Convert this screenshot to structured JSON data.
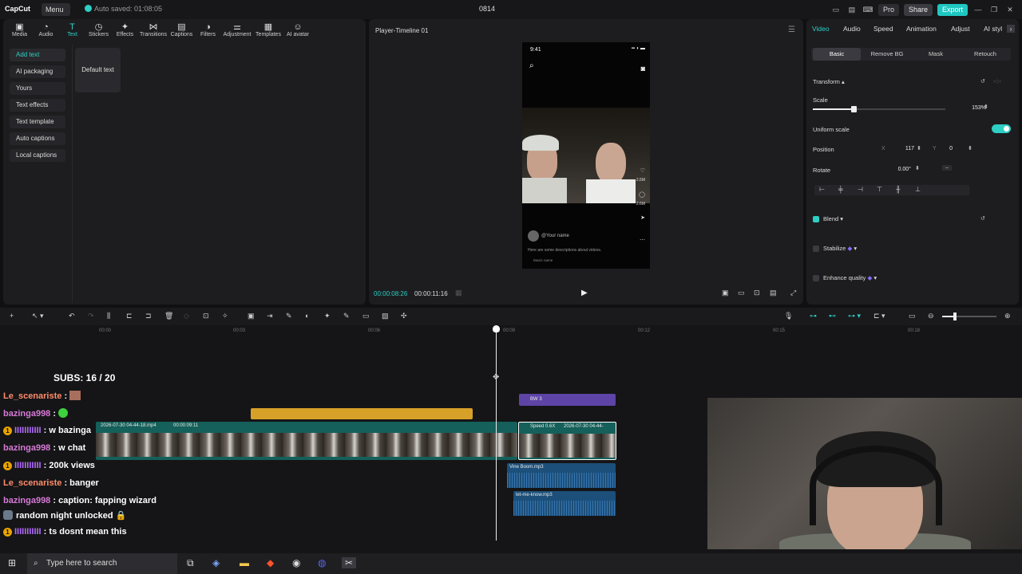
{
  "titlebar": {
    "app_name": "CapCut",
    "menu_label": "Menu",
    "autosave": "Auto saved: 01:08:05",
    "project_title": "0814",
    "pro_label": "Pro",
    "share_label": "Share",
    "export_label": "Export"
  },
  "media_tabs": [
    {
      "label": "Media",
      "icon": "media-icon"
    },
    {
      "label": "Audio",
      "icon": "audio-icon"
    },
    {
      "label": "Text",
      "icon": "text-icon",
      "active": true
    },
    {
      "label": "Stickers",
      "icon": "stickers-icon"
    },
    {
      "label": "Effects",
      "icon": "effects-icon"
    },
    {
      "label": "Transitions",
      "icon": "transitions-icon"
    },
    {
      "label": "Captions",
      "icon": "captions-icon"
    },
    {
      "label": "Filters",
      "icon": "filters-icon"
    },
    {
      "label": "Adjustment",
      "icon": "adjustment-icon"
    },
    {
      "label": "Templates",
      "icon": "templates-icon"
    },
    {
      "label": "AI avatar",
      "icon": "ai-avatar-icon"
    }
  ],
  "text_sidebar": [
    "Add text",
    "AI packaging",
    "Yours",
    "Text effects",
    "Text template",
    "Auto captions",
    "Local captions"
  ],
  "default_text_card": "Default text",
  "player": {
    "title": "Player-Timeline 01",
    "current_time": "00:00:08:26",
    "total_time": "00:00:11:16",
    "phone_time": "9:41",
    "phone_name": "@Your name",
    "phone_desc": "Here are some descriptions about videos.",
    "phone_music": "Music name",
    "likes": "2.6M",
    "comments": "2.6M"
  },
  "inspector": {
    "tabs": [
      "Video",
      "Audio",
      "Speed",
      "Animation",
      "Adjust",
      "AI styl"
    ],
    "subtabs": [
      "Basic",
      "Remove BG",
      "Mask",
      "Retouch"
    ],
    "transform_label": "Transform",
    "scale_label": "Scale",
    "scale_value": "153%",
    "scale_fraction": 0.31,
    "uniform_scale_label": "Uniform scale",
    "position_label": "Position",
    "pos_x_label": "X",
    "pos_x": "117",
    "pos_y_label": "Y",
    "pos_y": "0",
    "rotate_label": "Rotate",
    "rotate_value": "0.00°",
    "blend_label": "Blend",
    "stabilize_label": "Stabilize",
    "enhance_label": "Enhance quality"
  },
  "timeline": {
    "ruler": [
      "00:00",
      "00:03",
      "00:06",
      "00:09",
      "00:12",
      "00:15",
      "00:18"
    ],
    "bw_clip": "BW 3",
    "video_clip_name": "2026-07-30 04-44-18.mp4",
    "video_clip_dur": "00:00:09:11",
    "speed_badge": "Speed 0.6X",
    "video_clip2_name": "2026-07-30 04-44-",
    "audio1": "Vine Boom.mp3",
    "audio2": "let-me-know.mp3"
  },
  "overlay": {
    "subs": "SUBS: 16 / 20",
    "chat": [
      {
        "user": "Le_scenariste",
        "msg": " : ",
        "color": "#ff8c6b"
      },
      {
        "user": "bazinga998",
        "msg": " : ",
        "color": "#d77ad7"
      },
      {
        "user": "IIIIIIIIIII",
        "msg": " : w bazinga",
        "color": "#b36bff",
        "badge": "1"
      },
      {
        "user": "bazinga998",
        "msg": " : w chat",
        "color": "#d77ad7"
      },
      {
        "user": "IIIIIIIIIII",
        "msg": " : 200k views",
        "color": "#b36bff",
        "badge": "1"
      },
      {
        "user": "Le_scenariste",
        "msg": " : banger",
        "color": "#ff8c6b"
      },
      {
        "user": "bazinga998",
        "msg": " : caption: fapping wizard",
        "color": "#d77ad7"
      },
      {
        "user": "",
        "msg": "random night unlocked 🔒",
        "color": "#ffffff"
      },
      {
        "user": "IIIIIIIIIII",
        "msg": " : ts dosnt mean this",
        "color": "#b36bff",
        "badge": "1"
      }
    ]
  },
  "taskbar": {
    "search_placeholder": "Type here to search"
  },
  "colors": {
    "accent": "#2ecfc4",
    "bw_clip": "#5e44a6",
    "yellow_clip": "#d7a129",
    "video_clip": "#15605a",
    "audio_clip": "#1c4f7a"
  }
}
